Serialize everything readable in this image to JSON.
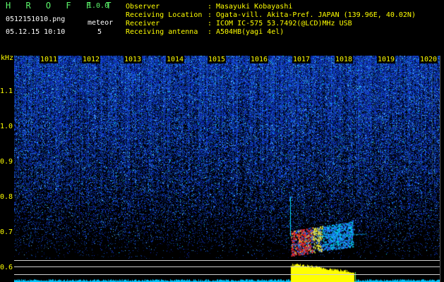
{
  "app": {
    "name": "H R O F F T",
    "version": "1.0.0"
  },
  "file": {
    "name": "0512151010.png",
    "datetime": "05.12.15 10:10"
  },
  "meteor": {
    "label": "meteor",
    "count": "5"
  },
  "header": {
    "rows": [
      {
        "label": "Observer",
        "value": "Masayuki Kobayashi"
      },
      {
        "label": "Receiving Location",
        "value": "Ogata-vill. Akita-Pref. JAPAN (139.96E, 40.02N)"
      },
      {
        "label": "Receiver",
        "value": "ICOM IC-575 53.7492(@LCD)MHz USB"
      },
      {
        "label": "Receiving antenna",
        "value": "A504HB(yagi 4el)"
      }
    ],
    "separator": ":"
  },
  "x_axis": {
    "labels": [
      "1011",
      "1012",
      "1013",
      "1014",
      "1015",
      "1016",
      "1017",
      "1018",
      "1019",
      "1020"
    ]
  },
  "y_axis": {
    "unit": "kHz",
    "labels": [
      "1.1",
      "1.0",
      "0.9",
      "0.8",
      "0.7",
      "0.6"
    ]
  },
  "colors": {
    "title": "#5cf86c",
    "text": "#ffff00",
    "info": "#ffffff",
    "noise": "#1e46ff",
    "echo_hot": "#ff2a2a",
    "echo_warm": "#ffff40",
    "echo_cool": "#00e0ff",
    "bottom_trace": "#ffff00",
    "bottom_baseline": "#00c8ff"
  }
}
